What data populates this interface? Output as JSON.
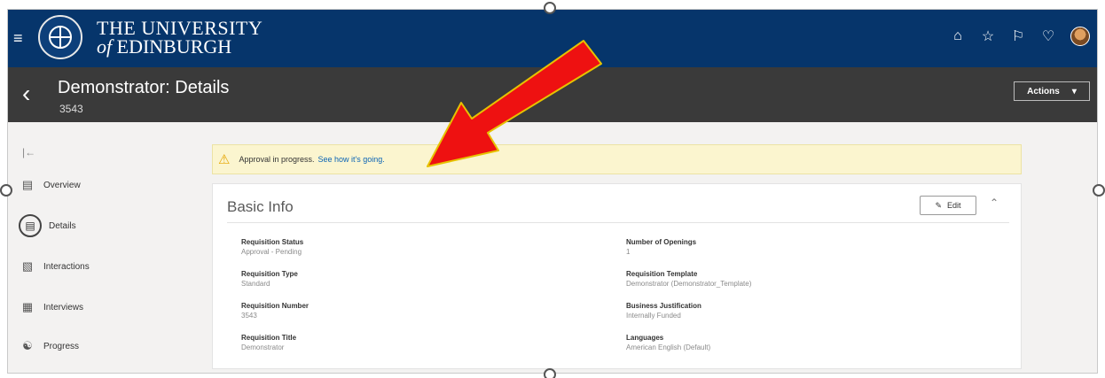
{
  "header": {
    "university_line1": "THE UNIVERSITY",
    "university_line2_prefix": "of",
    "university_line2_name": "EDINBURGH",
    "icons": [
      "menu-icon",
      "home-icon",
      "star-icon",
      "flag-icon",
      "bell-icon",
      "user-avatar"
    ]
  },
  "titlebar": {
    "title": "Demonstrator: Details",
    "subtitle": "3543",
    "actions_label": "Actions"
  },
  "sidebar": {
    "items": [
      {
        "label": "Overview",
        "icon": "overview-icon"
      },
      {
        "label": "Details",
        "icon": "details-icon",
        "active": true
      },
      {
        "label": "Interactions",
        "icon": "interactions-icon"
      },
      {
        "label": "Interviews",
        "icon": "interviews-icon"
      },
      {
        "label": "Progress",
        "icon": "progress-icon"
      }
    ]
  },
  "alert": {
    "message": "Approval in progress.",
    "link": "See how it's going."
  },
  "basic_info": {
    "title": "Basic Info",
    "edit_label": "Edit",
    "left_fields": [
      {
        "label": "Requisition Status",
        "value": "Approval - Pending"
      },
      {
        "label": "Requisition Type",
        "value": "Standard"
      },
      {
        "label": "Requisition Number",
        "value": "3543"
      },
      {
        "label": "Requisition Title",
        "value": "Demonstrator"
      }
    ],
    "right_fields": [
      {
        "label": "Number of Openings",
        "value": "1"
      },
      {
        "label": "Requisition Template",
        "value": "Demonstrator (Demonstrator_Template)"
      },
      {
        "label": "Business Justification",
        "value": "Internally Funded"
      },
      {
        "label": "Languages",
        "value": "American English (Default)"
      }
    ]
  },
  "colors": {
    "header_bg": "#06356b",
    "titlebar_bg": "#3a3a3a",
    "alert_bg": "#fbf5cf",
    "arrow": "#ee1111",
    "arrow_outline": "#e6c200",
    "link": "#0b64b5"
  }
}
